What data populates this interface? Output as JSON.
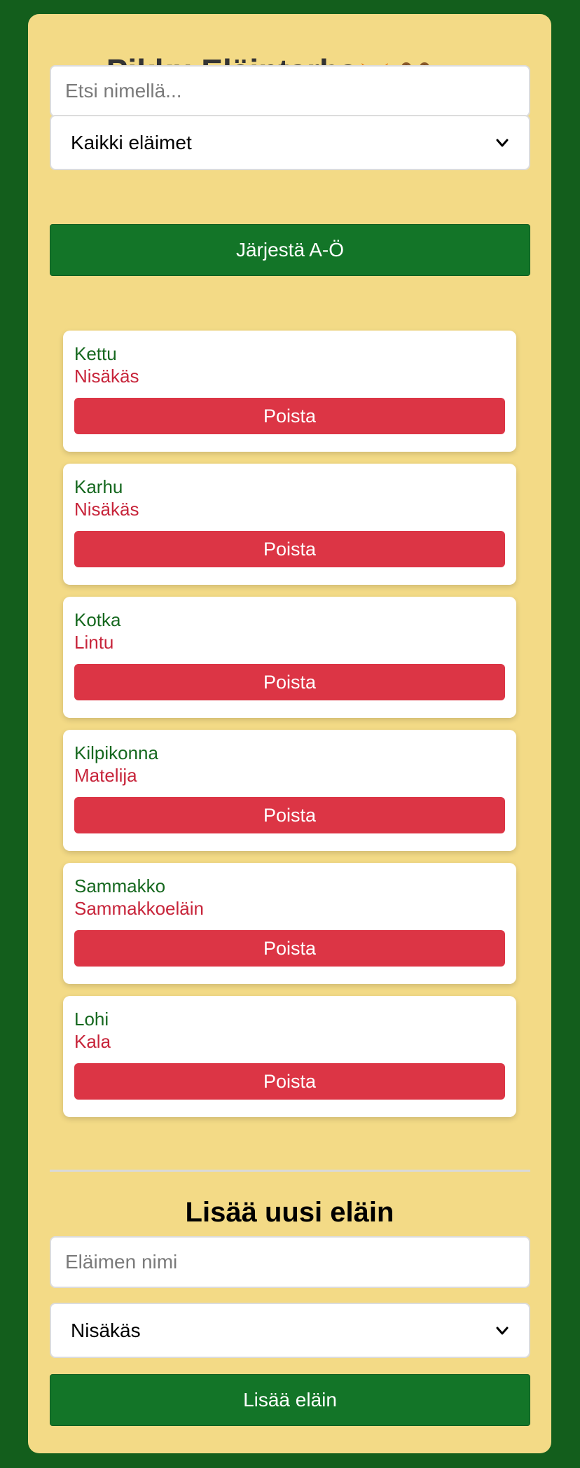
{
  "header": {
    "title": "Pikku Eläintarha",
    "emoji_icons": [
      "fox-icon",
      "bear-icon",
      "eagle-icon"
    ]
  },
  "search": {
    "placeholder": "Etsi nimellä...",
    "value": ""
  },
  "filter": {
    "selected": "Kaikki eläimet"
  },
  "sort_button": {
    "label": "Järjestä A-Ö"
  },
  "animals": [
    {
      "name": "Kettu",
      "type": "Nisäkäs",
      "delete_label": "Poista"
    },
    {
      "name": "Karhu",
      "type": "Nisäkäs",
      "delete_label": "Poista"
    },
    {
      "name": "Kotka",
      "type": "Lintu",
      "delete_label": "Poista"
    },
    {
      "name": "Kilpikonna",
      "type": "Matelija",
      "delete_label": "Poista"
    },
    {
      "name": "Sammakko",
      "type": "Sammakkoeläin",
      "delete_label": "Poista"
    },
    {
      "name": "Lohi",
      "type": "Kala",
      "delete_label": "Poista"
    }
  ],
  "add_form": {
    "title": "Lisää uusi eläin",
    "name_placeholder": "Eläimen nimi",
    "name_value": "",
    "type_selected": "Nisäkäs",
    "submit_label": "Lisää eläin"
  },
  "colors": {
    "page_background": "#135e1c",
    "panel_background": "#f3da86",
    "primary_button": "#137528",
    "delete_button": "#dc3545",
    "animal_name": "#16681f",
    "animal_type": "#c7243a"
  }
}
